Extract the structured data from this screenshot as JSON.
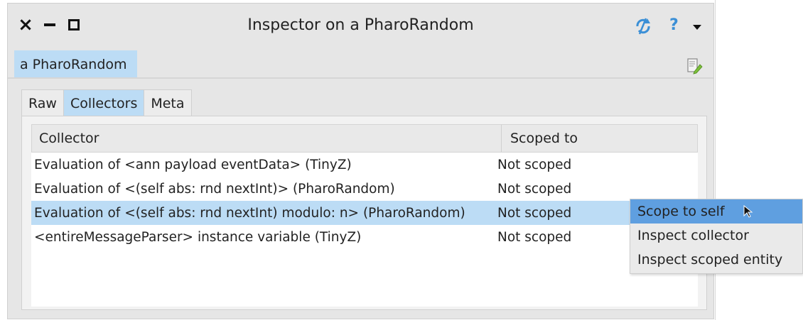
{
  "window": {
    "title": "Inspector on a PharoRandom",
    "close_glyph": "×"
  },
  "titlebar_icons": [
    "close-icon",
    "minimize-icon",
    "maximize-icon",
    "refresh-icon",
    "help-icon",
    "menu-arrow-icon"
  ],
  "help_glyph": "?",
  "page_tab": {
    "label": "a PharoRandom"
  },
  "subtabs": [
    {
      "label": "Raw",
      "active": false
    },
    {
      "label": "Collectors",
      "active": true
    },
    {
      "label": "Meta",
      "active": false
    }
  ],
  "table": {
    "headers": [
      "Collector",
      "Scoped to"
    ],
    "rows": [
      {
        "collector": "Evaluation of <ann payload eventData> (TinyZ)",
        "scoped_to": "Not scoped",
        "selected": false
      },
      {
        "collector": "Evaluation of <(self abs: rnd nextInt)> (PharoRandom)",
        "scoped_to": "Not scoped",
        "selected": false
      },
      {
        "collector": "Evaluation of <(self abs: rnd nextInt) modulo: n> (PharoRandom)",
        "scoped_to": "Not scoped",
        "selected": true
      },
      {
        "collector": "<entireMessageParser> instance variable (TinyZ)",
        "scoped_to": "Not scoped",
        "selected": false
      }
    ]
  },
  "context_menu": {
    "items": [
      {
        "label": "Scope to self",
        "hover": true
      },
      {
        "label": "Inspect collector",
        "hover": false
      },
      {
        "label": "Inspect scoped entity",
        "hover": false
      }
    ]
  },
  "colors": {
    "selection": "#bcdcf5",
    "menu_hover": "#5f9fe0",
    "accent_icon": "#3b8fd6"
  }
}
